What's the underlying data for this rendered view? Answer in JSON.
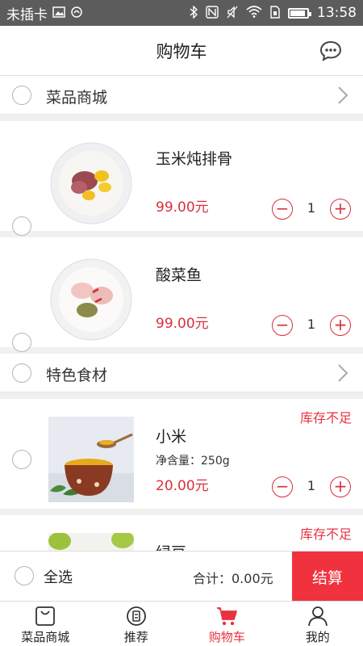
{
  "status_bar": {
    "carrier": "未插卡",
    "time": "13:58"
  },
  "header": {
    "title": "购物车"
  },
  "stores": [
    {
      "name": "菜品商城",
      "items": [
        {
          "name": "玉米炖排骨",
          "price": "99.00元",
          "qty": "1"
        },
        {
          "name": "酸菜鱼",
          "price": "99.00元",
          "qty": "1"
        }
      ]
    },
    {
      "name": "特色食材",
      "items": [
        {
          "name": "小米",
          "spec": "净含量：250g",
          "price": "20.00元",
          "qty": "1",
          "warning": "库存不足"
        },
        {
          "name": "绿豆",
          "warning": "库存不足"
        }
      ]
    }
  ],
  "checkout": {
    "select_all": "全选",
    "total": "合计：0.00元",
    "pay": "结算"
  },
  "tabs": [
    {
      "label": "菜品商城",
      "icon": "bag-icon"
    },
    {
      "label": "推荐",
      "icon": "recommend-icon"
    },
    {
      "label": "购物车",
      "icon": "cart-icon",
      "active": true
    },
    {
      "label": "我的",
      "icon": "user-icon"
    }
  ],
  "colors": {
    "accent": "#e8323f",
    "price": "#d9303e"
  }
}
